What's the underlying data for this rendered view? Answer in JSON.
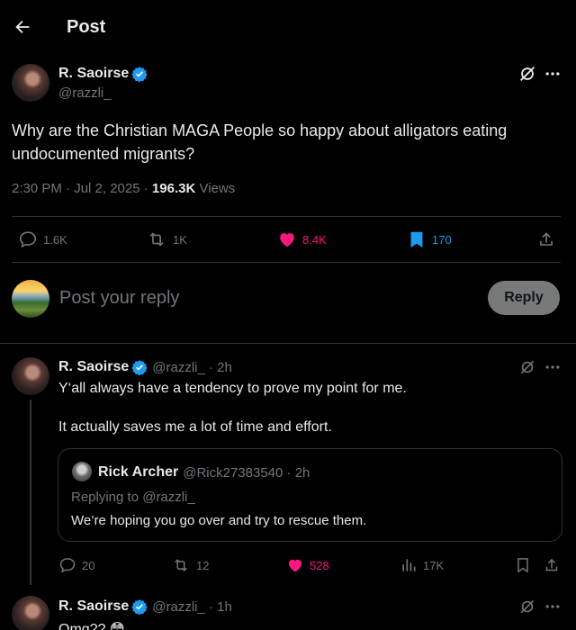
{
  "header": {
    "title": "Post"
  },
  "post": {
    "author_name": "R. Saoirse",
    "author_handle": "@razzli_",
    "text": "Why are the Christian MAGA People so happy about alligators eating undocumented migrants?",
    "timestamp": "2:30 PM · Jul 2, 2025 · ",
    "views_count": "196.3K",
    "views_label": " Views",
    "stats": {
      "replies": "1.6K",
      "reposts": "1K",
      "likes": "8.4K",
      "bookmarks": "170"
    }
  },
  "composer": {
    "placeholder": "Post your reply",
    "reply_label": "Reply"
  },
  "reply1": {
    "author_name": "R. Saoirse",
    "handle_time": "@razzli_ · 2h",
    "line1": "Y‘all always have a tendency to prove my point for me.",
    "line2": "It actually saves me a lot of time and effort.",
    "quote": {
      "author_name": "Rick Archer",
      "handle_time": "@Rick27383540 · 2h",
      "replying_to": "Replying to @razzli_",
      "text": "We’re hoping you go over and try to rescue them."
    },
    "stats": {
      "replies": "20",
      "reposts": "12",
      "likes": "528",
      "views": "17K"
    }
  },
  "reply2": {
    "author_name": "R. Saoirse",
    "handle_time": "@razzli_ · 1h",
    "text": "Omg?? 😳"
  },
  "colors": {
    "like": "#f91880",
    "bookmark": "#1d9bf0",
    "verified": "#1d9bf0",
    "muted": "#71767b"
  }
}
